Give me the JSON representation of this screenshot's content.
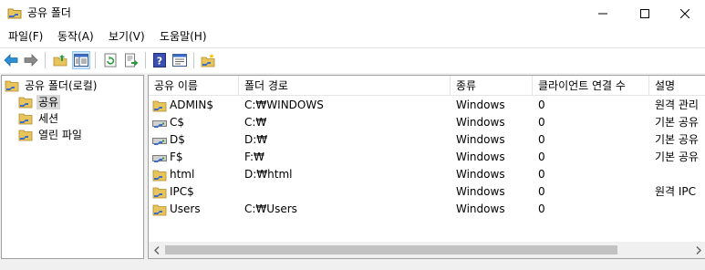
{
  "window": {
    "title": "공유 폴더",
    "icons": {
      "app": "shared-folder-icon",
      "minimize": "minimize-icon",
      "maximize": "maximize-icon",
      "close": "close-icon"
    }
  },
  "menu": [
    {
      "label": "파일(F)"
    },
    {
      "label": "동작(A)"
    },
    {
      "label": "보기(V)"
    },
    {
      "label": "도움말(H)"
    }
  ],
  "toolbar": {
    "buttons": [
      "back-icon",
      "forward-icon",
      "up-folder-icon",
      "show-hide-tree-icon",
      "refresh-icon",
      "export-list-icon",
      "help-icon",
      "properties-icon",
      "new-share-icon"
    ],
    "pressed": "show-hide-tree-icon"
  },
  "tree": {
    "root": "공유 폴더(로컬)",
    "items": [
      {
        "label": "공유",
        "selected": true
      },
      {
        "label": "세션",
        "selected": false
      },
      {
        "label": "열린 파일",
        "selected": false
      }
    ]
  },
  "list": {
    "columns": [
      "공유 이름",
      "폴더 경로",
      "종류",
      "클라이언트 연결 수",
      "설명"
    ],
    "rows": [
      {
        "name": "ADMIN$",
        "path": "C:₩WINDOWS",
        "type": "Windows",
        "clients": "0",
        "desc": "원격 관리",
        "icon": "admin-share-icon"
      },
      {
        "name": "C$",
        "path": "C:₩",
        "type": "Windows",
        "clients": "0",
        "desc": "기본 공유",
        "icon": "drive-share-icon"
      },
      {
        "name": "D$",
        "path": "D:₩",
        "type": "Windows",
        "clients": "0",
        "desc": "기본 공유",
        "icon": "drive-share-icon"
      },
      {
        "name": "F$",
        "path": "F:₩",
        "type": "Windows",
        "clients": "0",
        "desc": "기본 공유",
        "icon": "drive-share-icon"
      },
      {
        "name": "html",
        "path": "D:₩html",
        "type": "Windows",
        "clients": "0",
        "desc": "",
        "icon": "folder-share-icon"
      },
      {
        "name": "IPC$",
        "path": "",
        "type": "Windows",
        "clients": "0",
        "desc": "원격 IPC",
        "icon": "folder-share-icon"
      },
      {
        "name": "Users",
        "path": "C:₩Users",
        "type": "Windows",
        "clients": "0",
        "desc": "",
        "icon": "folder-share-icon"
      }
    ]
  },
  "colors": {
    "selection": "#d9d9d9",
    "toolbar_pressed": "#cce4f7",
    "folder": "#e8c45c",
    "hand": "#3a6cc8"
  }
}
